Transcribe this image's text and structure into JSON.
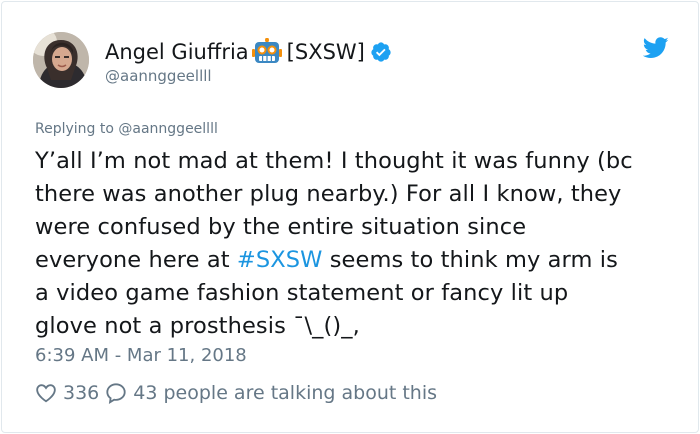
{
  "author": {
    "name": "Angel Giuffria",
    "name_suffix": "[SXSW]",
    "handle": "@aannggeellll"
  },
  "replying_to": {
    "prefix": "Replying to",
    "handle": "@aannggeellll"
  },
  "tweet": {
    "lines": [
      "Y’all I’m not mad at them! I thought it was funny (bc",
      "there was another plug nearby.) For all I know, they",
      "were confused by the entire situation since",
      "everyone here at ",
      "a video game fashion statement or fancy lit up",
      "glove not a prosthesis ¯\\_()_,"
    ],
    "hashtag": "#SXSW",
    "after_hashtag": " seems to think my arm is"
  },
  "timestamp": "6:39 AM - Mar 11, 2018",
  "actions": {
    "like_count": "336",
    "reply_text": "43 people are talking about this"
  },
  "colors": {
    "link": "#1b95e0",
    "secondary": "#657786",
    "verified": "#1da1f2",
    "like_outline": "#657786"
  },
  "icons": {
    "verified": "verified-badge-icon",
    "bird": "twitter-bird-icon",
    "robot": "robot-face-emoji",
    "like": "heart-outline-icon",
    "reply": "speech-bubble-icon"
  }
}
